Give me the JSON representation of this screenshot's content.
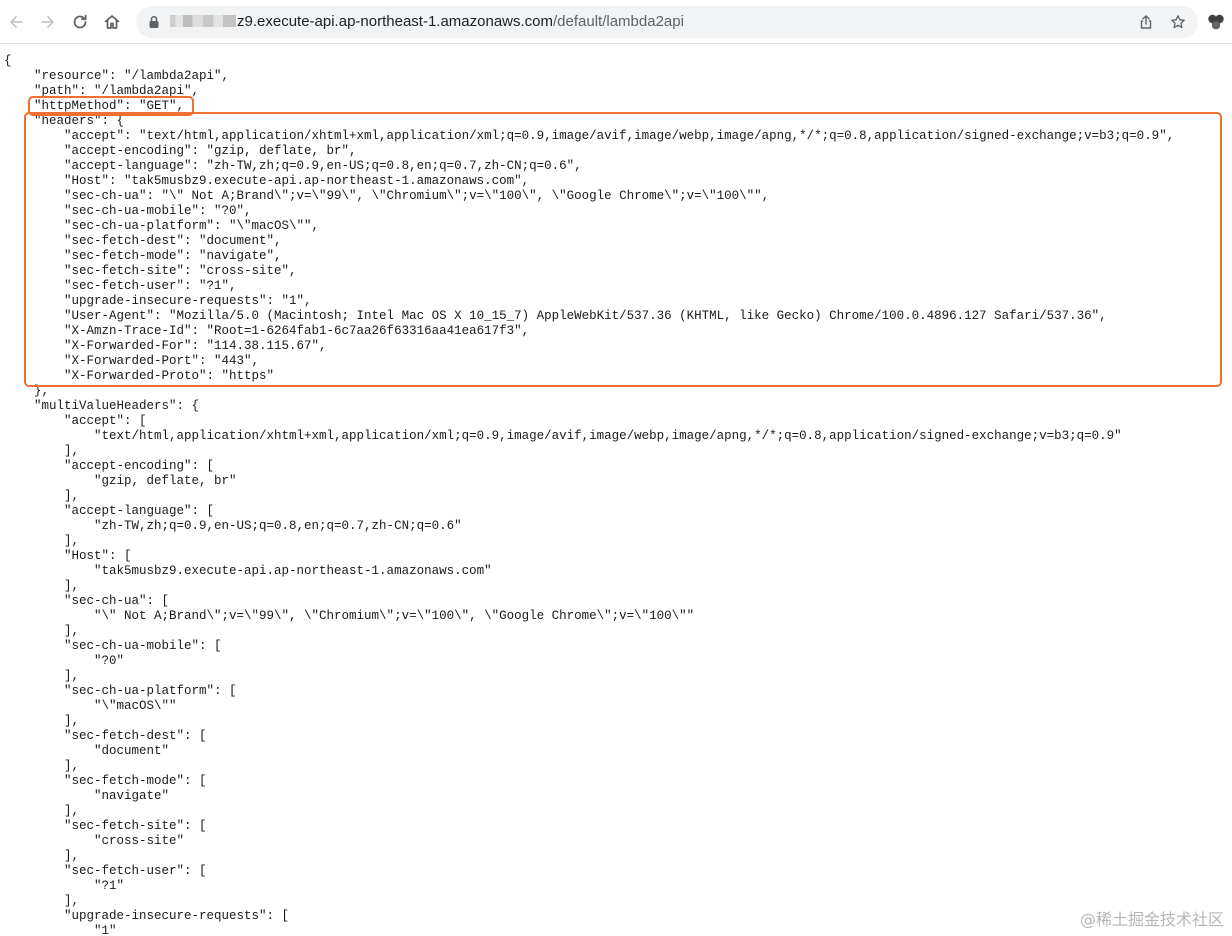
{
  "browser": {
    "url_host": "z9.execute-api.ap-northeast-1.amazonaws.com",
    "url_path": "/default/lambda2api",
    "icons": [
      "back-arrow-icon",
      "forward-arrow-icon",
      "reload-icon",
      "home-icon",
      "lock-icon",
      "share-icon",
      "bookmark-star-icon",
      "extensions-icon"
    ]
  },
  "code_lines": [
    "{",
    "    \"resource\": \"/lambda2api\",",
    "    \"path\": \"/lambda2api\",",
    "    \"httpMethod\": \"GET\",",
    "    \"headers\": {",
    "        \"accept\": \"text/html,application/xhtml+xml,application/xml;q=0.9,image/avif,image/webp,image/apng,*/*;q=0.8,application/signed-exchange;v=b3;q=0.9\",",
    "        \"accept-encoding\": \"gzip, deflate, br\",",
    "        \"accept-language\": \"zh-TW,zh;q=0.9,en-US;q=0.8,en;q=0.7,zh-CN;q=0.6\",",
    "        \"Host\": \"tak5musbz9.execute-api.ap-northeast-1.amazonaws.com\",",
    "        \"sec-ch-ua\": \"\\\" Not A;Brand\\\";v=\\\"99\\\", \\\"Chromium\\\";v=\\\"100\\\", \\\"Google Chrome\\\";v=\\\"100\\\"\",",
    "        \"sec-ch-ua-mobile\": \"?0\",",
    "        \"sec-ch-ua-platform\": \"\\\"macOS\\\"\",",
    "        \"sec-fetch-dest\": \"document\",",
    "        \"sec-fetch-mode\": \"navigate\",",
    "        \"sec-fetch-site\": \"cross-site\",",
    "        \"sec-fetch-user\": \"?1\",",
    "        \"upgrade-insecure-requests\": \"1\",",
    "        \"User-Agent\": \"Mozilla/5.0 (Macintosh; Intel Mac OS X 10_15_7) AppleWebKit/537.36 (KHTML, like Gecko) Chrome/100.0.4896.127 Safari/537.36\",",
    "        \"X-Amzn-Trace-Id\": \"Root=1-6264fab1-6c7aa26f63316aa41ea617f3\",",
    "        \"X-Forwarded-For\": \"114.38.115.67\",",
    "        \"X-Forwarded-Port\": \"443\",",
    "        \"X-Forwarded-Proto\": \"https\"",
    "    },",
    "    \"multiValueHeaders\": {",
    "        \"accept\": [",
    "            \"text/html,application/xhtml+xml,application/xml;q=0.9,image/avif,image/webp,image/apng,*/*;q=0.8,application/signed-exchange;v=b3;q=0.9\"",
    "        ],",
    "        \"accept-encoding\": [",
    "            \"gzip, deflate, br\"",
    "        ],",
    "        \"accept-language\": [",
    "            \"zh-TW,zh;q=0.9,en-US;q=0.8,en;q=0.7,zh-CN;q=0.6\"",
    "        ],",
    "        \"Host\": [",
    "            \"tak5musbz9.execute-api.ap-northeast-1.amazonaws.com\"",
    "        ],",
    "        \"sec-ch-ua\": [",
    "            \"\\\" Not A;Brand\\\";v=\\\"99\\\", \\\"Chromium\\\";v=\\\"100\\\", \\\"Google Chrome\\\";v=\\\"100\\\"\"",
    "        ],",
    "        \"sec-ch-ua-mobile\": [",
    "            \"?0\"",
    "        ],",
    "        \"sec-ch-ua-platform\": [",
    "            \"\\\"macOS\\\"\"",
    "        ],",
    "        \"sec-fetch-dest\": [",
    "            \"document\"",
    "        ],",
    "        \"sec-fetch-mode\": [",
    "            \"navigate\"",
    "        ],",
    "        \"sec-fetch-site\": [",
    "            \"cross-site\"",
    "        ],",
    "        \"sec-fetch-user\": [",
    "            \"?1\"",
    "        ],",
    "        \"upgrade-insecure-requests\": [",
    "            \"1\""
  ],
  "highlight_color": "#f07030",
  "watermark": "@稀土掘金技术社区"
}
